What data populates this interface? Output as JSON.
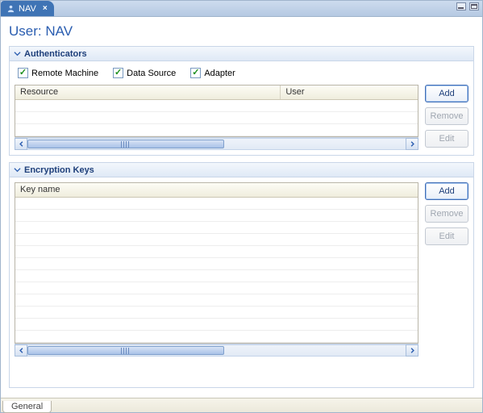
{
  "tab": {
    "title": "NAV"
  },
  "page": {
    "title": "User: NAV"
  },
  "sections": {
    "authenticators": {
      "title": "Authenticators",
      "checks": {
        "remote_machine": {
          "label": "Remote Machine",
          "checked": true
        },
        "data_source": {
          "label": "Data Source",
          "checked": true
        },
        "adapter": {
          "label": "Adapter",
          "checked": true
        }
      },
      "columns": {
        "resource": "Resource",
        "user": "User"
      },
      "rows": [],
      "buttons": {
        "add": "Add",
        "remove": "Remove",
        "edit": "Edit"
      }
    },
    "encryption_keys": {
      "title": "Encryption Keys",
      "columns": {
        "key_name": "Key name"
      },
      "rows": [],
      "buttons": {
        "add": "Add",
        "remove": "Remove",
        "edit": "Edit"
      }
    }
  },
  "bottom_tabs": {
    "general": "General"
  }
}
